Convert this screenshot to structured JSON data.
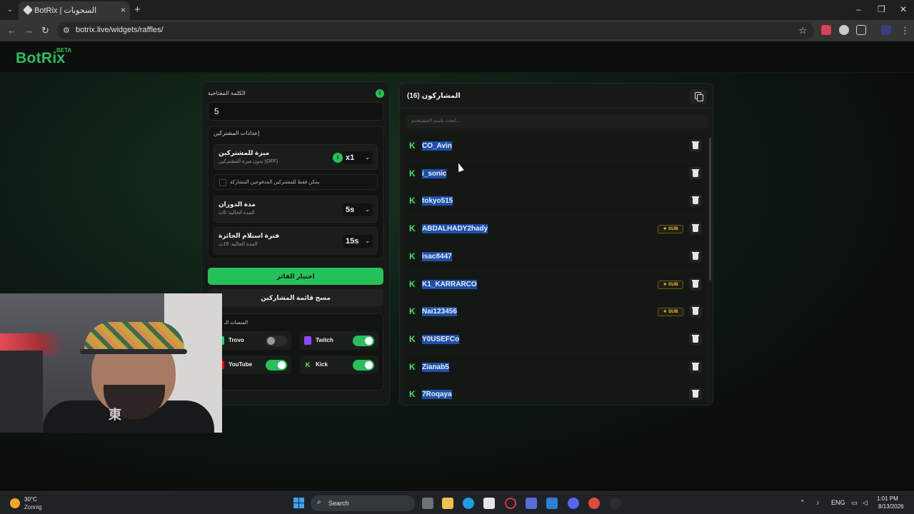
{
  "browser": {
    "tab_title": "BotRix | السحوبات",
    "url": "botrix.live/widgets/raffles/",
    "new_tab": "+",
    "tab_close": "×",
    "win_minimize": "–",
    "win_restore": "❐",
    "win_close": "✕"
  },
  "app": {
    "logo": "BotRix",
    "badge": "BETA"
  },
  "settings": {
    "keyword_label": "الكلمة المفتاحية",
    "keyword_value": "5",
    "participants_section": "إعدادات المشتركين",
    "subscriber_perk_title": "ميزة للمشتركين",
    "subscriber_perk_sub": "بدون ميزة المشتركين (OFF)",
    "subscriber_perk_value": "x1",
    "paid_only_label": "يمكن فقط للمشتركين المدفوعين المشاركة",
    "spin_duration_title": "مدة الدوران",
    "spin_duration_sub": "المدة الحالية: 5ث",
    "spin_duration_value": "5s",
    "claim_period_title": "فترة استلام الجائزة",
    "claim_period_sub": "المدة الحالية: 15ث",
    "claim_period_value": "15s",
    "pick_winner": "اختيار الفائز",
    "clear_list": "مسح قائمة المشاركين",
    "platforms_title": "المنصات الـ",
    "platforms": [
      {
        "name": "Trovo",
        "enabled": false,
        "color": "#19d66b"
      },
      {
        "name": "Twitch",
        "enabled": true,
        "color": "#9146ff"
      },
      {
        "name": "YouTube",
        "enabled": true,
        "color": "#ff0000"
      },
      {
        "name": "Kick",
        "enabled": true,
        "color": "#53fc18"
      }
    ],
    "accent_color": "#27c15b"
  },
  "participants": {
    "title": "المشاركون (16)",
    "search_placeholder": "ابحث باسم المستخدم...",
    "sub_label": "SUB",
    "list": [
      {
        "name": "CO_Avin",
        "sub": false
      },
      {
        "name": "i_sonic",
        "sub": false
      },
      {
        "name": "tokyo515",
        "sub": false
      },
      {
        "name": "ABDALHADY2hady",
        "sub": true
      },
      {
        "name": "isac8447",
        "sub": false
      },
      {
        "name": "K1_KARRARCO",
        "sub": true
      },
      {
        "name": "Nai123456",
        "sub": true
      },
      {
        "name": "Y0USEFCo",
        "sub": false
      },
      {
        "name": "Zianab5",
        "sub": false
      },
      {
        "name": "7Roqaya",
        "sub": false
      }
    ]
  },
  "webcam": {
    "shirt_logo": "東"
  },
  "taskbar": {
    "weather_temp": "30°C",
    "weather_desc": "Zonnig",
    "search_label": "Search",
    "language": "ENG",
    "time": "1:01 PM",
    "date": "8/13/2026"
  }
}
